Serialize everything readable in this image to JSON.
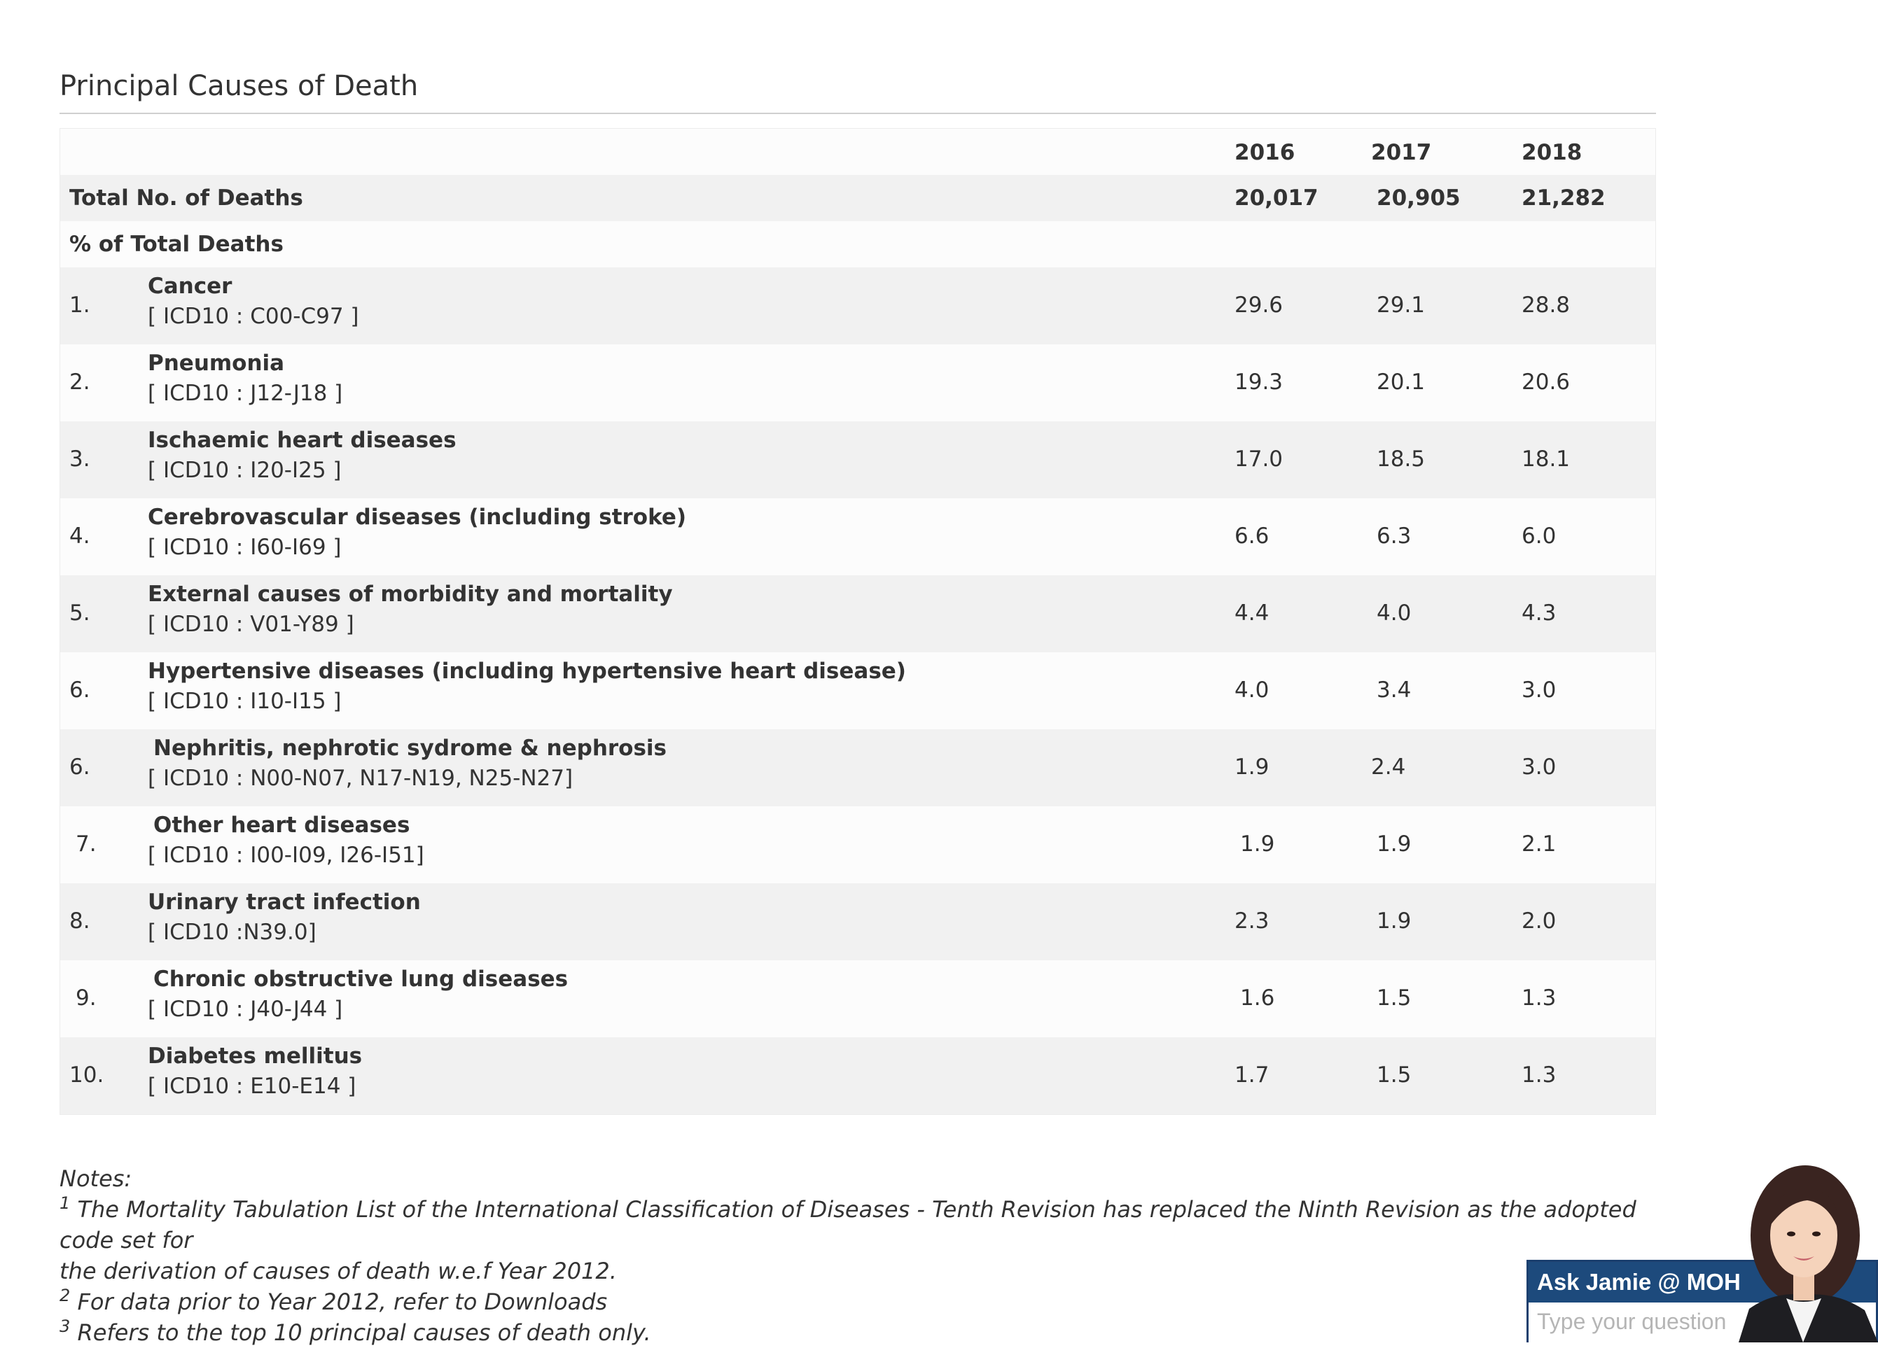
{
  "page": {
    "title": "Principal Causes of Death"
  },
  "table": {
    "years": [
      "2016",
      "2017",
      "2018"
    ],
    "total_label": "Total No. of Deaths",
    "totals": [
      "20,017",
      "20,905",
      "21,282"
    ],
    "pct_label": "% of Total Deaths",
    "causes": [
      {
        "rank": "1.",
        "name": "Cancer",
        "code": "[ ICD10 : C00-C97 ]",
        "values": [
          "29.6",
          "29.1",
          "28.8"
        ]
      },
      {
        "rank": "2.",
        "name": "Pneumonia",
        "code": "[ ICD10 : J12-J18 ]",
        "values": [
          "19.3",
          "20.1",
          "20.6"
        ]
      },
      {
        "rank": "3.",
        "name": "Ischaemic heart diseases",
        "code": "[ ICD10 : I20-I25 ]",
        "values": [
          "17.0",
          "18.5",
          "18.1"
        ]
      },
      {
        "rank": "4.",
        "name": "Cerebrovascular diseases (including stroke)",
        "code": "[ ICD10 : I60-I69 ]",
        "values": [
          "6.6",
          "6.3",
          "6.0"
        ]
      },
      {
        "rank": "5.",
        "name": "External causes of morbidity and mortality",
        "code": "[ ICD10 : V01-Y89 ]",
        "values": [
          "4.4",
          "4.0",
          "4.3"
        ]
      },
      {
        "rank": "6.",
        "name": "Hypertensive diseases (including hypertensive heart disease)",
        "code": "[ ICD10 : I10-I15 ]",
        "values": [
          "4.0",
          "3.4",
          "3.0"
        ]
      },
      {
        "rank": "6.",
        "name": "Nephritis, nephrotic sydrome & nephrosis",
        "code": "[ ICD10 : N00-N07, N17-N19, N25-N27]",
        "values": [
          "1.9",
          "2.4",
          "3.0"
        ]
      },
      {
        "rank": "7.",
        "name": "Other heart diseases",
        "code": "[ ICD10 : I00-I09, I26-I51]",
        "values": [
          "1.9",
          "1.9",
          "2.1"
        ]
      },
      {
        "rank": "8.",
        "name": "Urinary tract infection",
        "code": "[ ICD10 :N39.0]",
        "values": [
          "2.3",
          "1.9",
          "2.0"
        ]
      },
      {
        "rank": "9.",
        "name": "Chronic obstructive lung diseases",
        "code": "[ ICD10 : J40-J44 ]",
        "values": [
          "1.6",
          "1.5",
          "1.3"
        ]
      },
      {
        "rank": "10.",
        "name": "Diabetes mellitus",
        "code": "[ ICD10 : E10-E14 ]",
        "values": [
          "1.7",
          "1.5",
          "1.3"
        ]
      }
    ]
  },
  "notes": {
    "heading": "Notes:",
    "items": [
      {
        "marker": "1",
        "text": "The Mortality Tabulation List of the International Classification of Diseases - Tenth Revision has replaced the Ninth Revision as the adopted code set for"
      },
      {
        "marker": "",
        "text": "the derivation of causes of death w.e.f Year 2012."
      },
      {
        "marker": "2",
        "text": "For data prior to Year 2012, refer to Downloads"
      },
      {
        "marker": "3",
        "text": "Refers to the top 10 principal causes of death only."
      }
    ]
  },
  "chat": {
    "title": "Ask Jamie @ MOH",
    "placeholder": "Type your question"
  }
}
